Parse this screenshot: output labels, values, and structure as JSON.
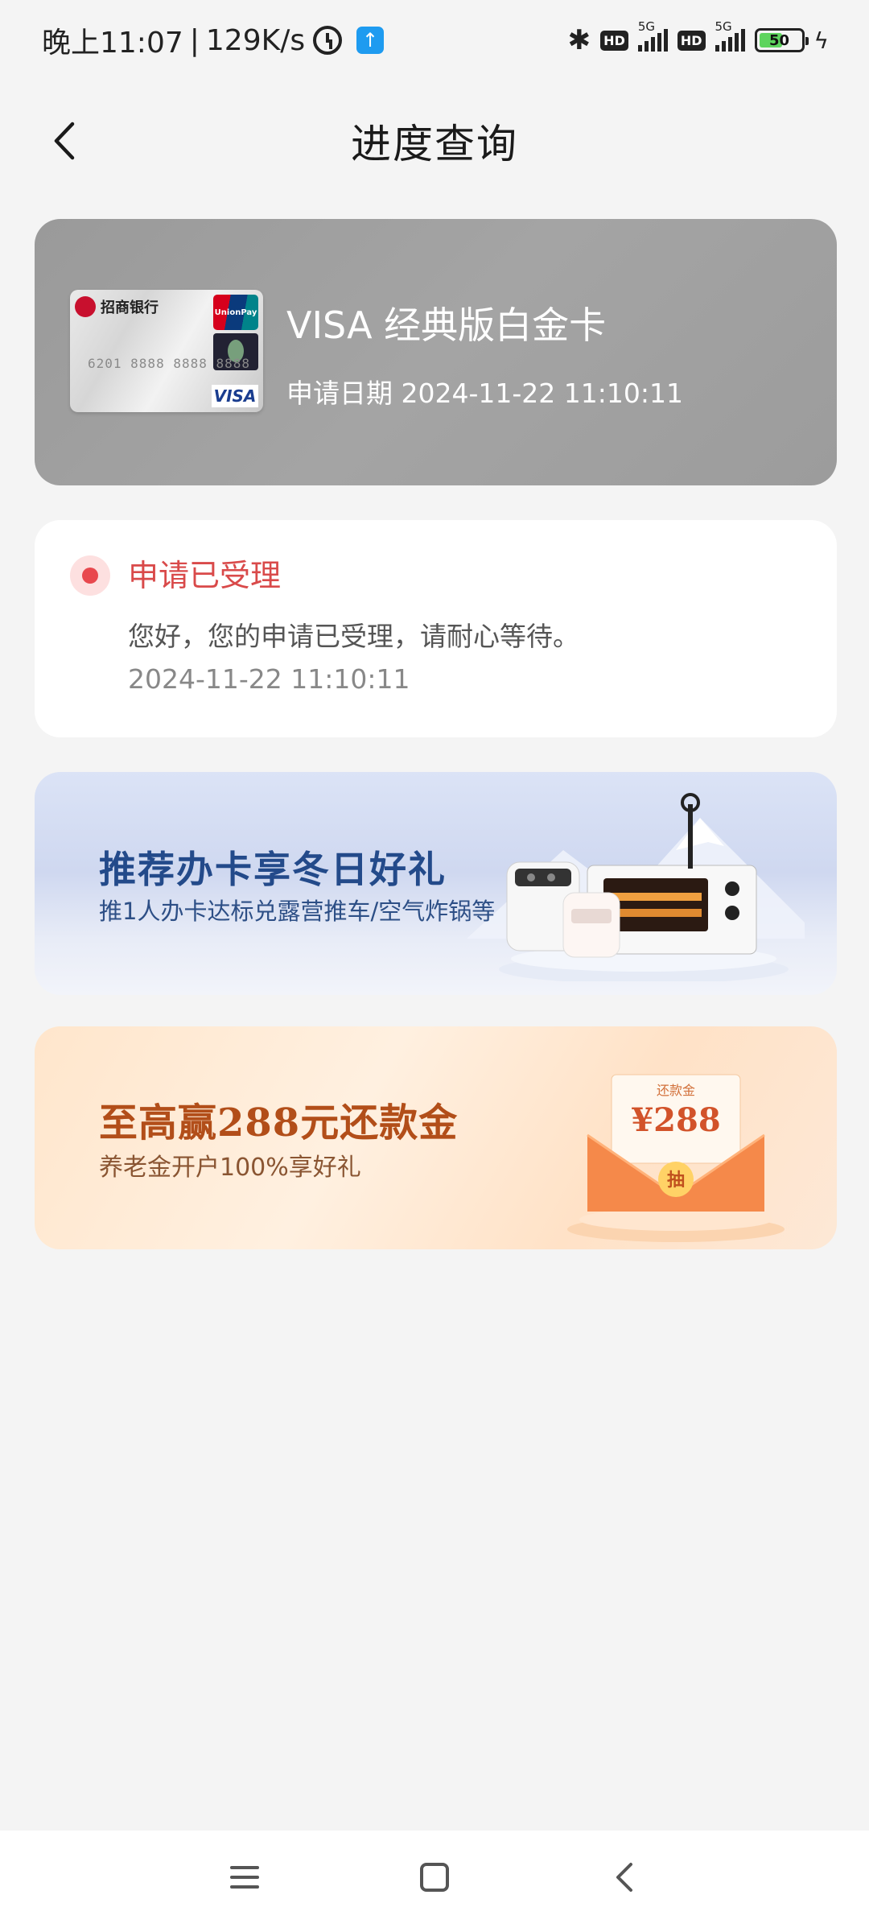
{
  "status_bar": {
    "time": "晚上11:07",
    "separator": "|",
    "network_speed": "129K/s",
    "network_type_1": "5G",
    "network_type_2": "5G",
    "hd_label": "HD",
    "battery_level": "50",
    "icons": [
      "alarm-icon",
      "upload-icon",
      "bluetooth-icon",
      "signal-icon",
      "battery-icon",
      "charging-icon"
    ]
  },
  "header": {
    "title": "进度查询",
    "back_icon": "chevron-left-icon"
  },
  "card": {
    "name": "VISA 经典版白金卡",
    "date_label": "申请日期",
    "date_value": "2024-11-22 11:10:11",
    "image": {
      "bank_name": "招商银行",
      "network_badge": "UnionPay",
      "number_text": "6201 8888 8888 8888",
      "brand": "VISA"
    }
  },
  "progress": {
    "title": "申请已受理",
    "message": "您好，您的申请已受理，请耐心等待。",
    "time": "2024-11-22 11:10:11",
    "accent_color": "#e8484e"
  },
  "banners": [
    {
      "title": "推荐办卡享冬日好礼",
      "subtitle": "推1人办卡达标兑露营推车/空气炸锅等"
    },
    {
      "title": "至高赢288元还款金",
      "subtitle": "养老金开户100%享好礼",
      "envelope_label": "还款金",
      "envelope_amount": "¥288",
      "envelope_button": "抽"
    }
  ],
  "bottom_nav": {
    "icons": [
      "menu-icon",
      "home-icon",
      "back-icon"
    ]
  }
}
